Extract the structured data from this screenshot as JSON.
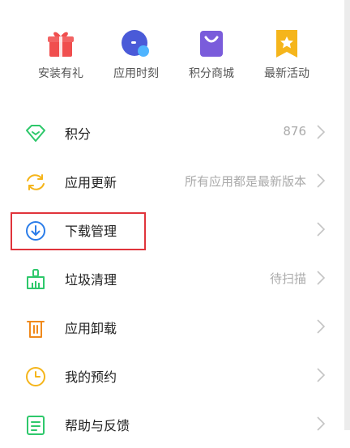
{
  "quick_actions": [
    {
      "label": "安装有礼",
      "icon": "gift-icon",
      "color": "#f04e4e"
    },
    {
      "label": "应用时刻",
      "icon": "app-moment-icon",
      "color": "#4a5ad8"
    },
    {
      "label": "积分商城",
      "icon": "shopping-bag-icon",
      "color": "#7a5cdb"
    },
    {
      "label": "最新活动",
      "icon": "event-badge-icon",
      "color": "#f5b51b"
    }
  ],
  "menu": [
    {
      "label": "积分",
      "value": "876",
      "icon": "diamond-icon",
      "color": "#2ec86b"
    },
    {
      "label": "应用更新",
      "value": "所有应用都是最新版本",
      "icon": "refresh-icon",
      "color": "#f5b51b"
    },
    {
      "label": "下载管理",
      "value": "",
      "icon": "download-icon",
      "color": "#2b7de9"
    },
    {
      "label": "垃圾清理",
      "value": "待扫描",
      "icon": "broom-icon",
      "color": "#2ec86b"
    },
    {
      "label": "应用卸载",
      "value": "",
      "icon": "trash-icon",
      "color": "#f08a1c"
    },
    {
      "label": "我的预约",
      "value": "",
      "icon": "clock-icon",
      "color": "#f5b51b"
    },
    {
      "label": "帮助与反馈",
      "value": "",
      "icon": "feedback-icon",
      "color": "#2ec86b"
    }
  ],
  "highlight_color": "#e0343b"
}
